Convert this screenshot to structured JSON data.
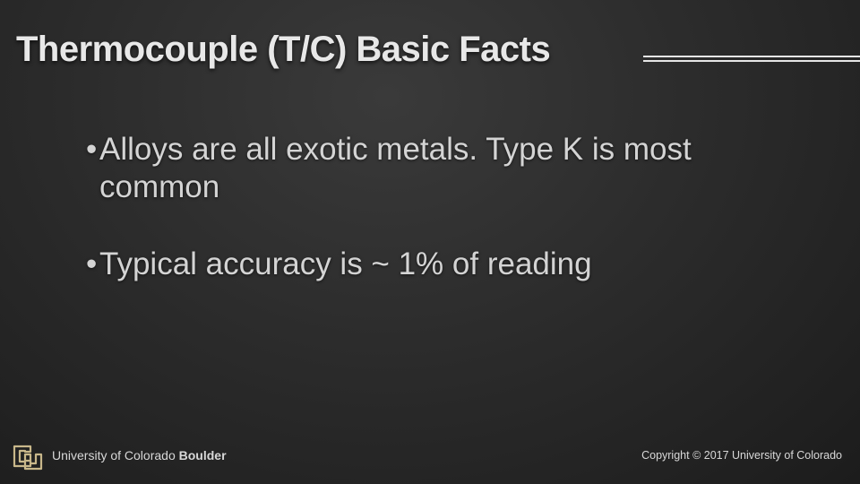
{
  "slide": {
    "title": "Thermocouple (T/C) Basic Facts",
    "bullet_char": "•",
    "bullets": [
      "Alloys are all exotic metals. Type K is most common",
      "Typical accuracy is ~ 1% of reading"
    ]
  },
  "footer": {
    "logo_icon": "cu-logo-icon",
    "university_prefix": "University of Colorado",
    "university_campus": "Boulder",
    "copyright": "Copyright © 2017 University of Colorado"
  },
  "colors": {
    "background": "#2c2c2c",
    "title": "#e8e8e8",
    "text": "#d4d4d4",
    "logo_gold": "#c8b78a"
  }
}
